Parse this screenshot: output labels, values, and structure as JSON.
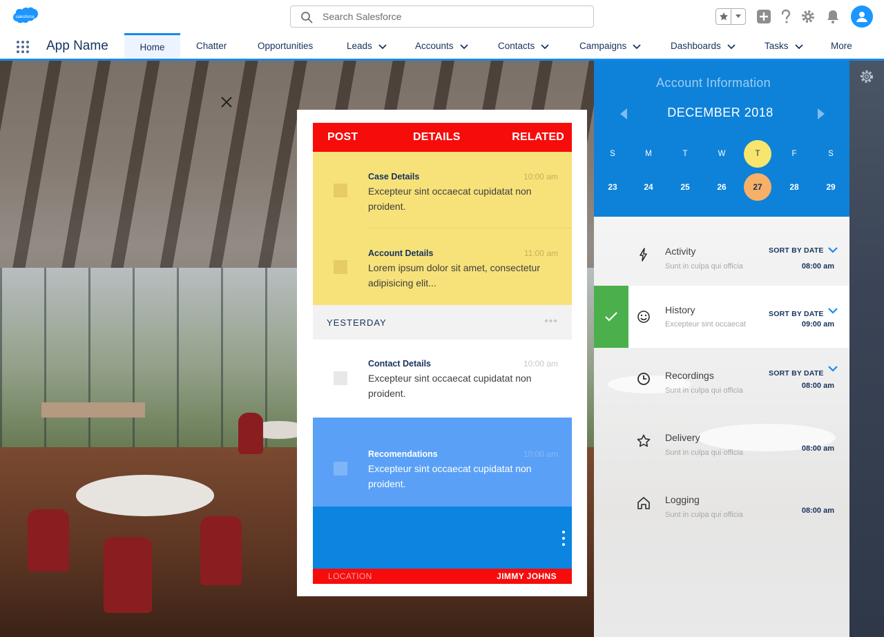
{
  "header": {
    "logo_text": "salesforce",
    "search_placeholder": "Search Salesforce"
  },
  "nav": {
    "app_name": "App Name",
    "tabs": [
      {
        "label": "Home",
        "active": true,
        "dropdown": false
      },
      {
        "label": "Chatter",
        "dropdown": false
      },
      {
        "label": "Opportunities",
        "dropdown": false
      },
      {
        "label": "Leads",
        "dropdown": true
      },
      {
        "label": "Accounts",
        "dropdown": true
      },
      {
        "label": "Contacts",
        "dropdown": true
      },
      {
        "label": "Campaigns",
        "dropdown": true
      },
      {
        "label": "Dashboards",
        "dropdown": true
      },
      {
        "label": "Tasks",
        "dropdown": true
      },
      {
        "label": "More",
        "dropdown": false
      }
    ]
  },
  "card": {
    "tabs": {
      "post": "POST",
      "details": "DETAILS",
      "related": "RELATED"
    },
    "items": [
      {
        "title": "Case Details",
        "time": "10:00 am",
        "body": "Excepteur sint occaecat cupidatat non proident."
      },
      {
        "title": "Account Details",
        "time": "11:00 am",
        "body": "Lorem ipsum dolor sit amet, consectetur adipisicing elit..."
      },
      {
        "title": "Contact Details",
        "time": "10:00 am",
        "body": "Excepteur sint occaecat cupidatat non proident."
      },
      {
        "title": "Recomendations",
        "time": "10:00 am",
        "body": "Excepteur sint occaecat cupidatat non proident."
      }
    ],
    "section_label": "YESTERDAY",
    "more_dots": "•••",
    "footer": {
      "location": "LOCATION",
      "name": "JIMMY JOHNS"
    }
  },
  "calendar": {
    "title": "Account Information",
    "month": "DECEMBER 2018",
    "days_of_week": [
      "S",
      "M",
      "T",
      "W",
      "T",
      "F",
      "S"
    ],
    "dates": [
      "23",
      "24",
      "25",
      "26",
      "27",
      "28",
      "29"
    ],
    "highlight_index": 4
  },
  "activities": [
    {
      "name": "Activity",
      "sub": "Sunt in culpa qui officia",
      "sort": "SORT BY DATE",
      "time": "08:00 am",
      "icon": "lightning-icon"
    },
    {
      "name": "History",
      "sub": "Excepteur sint occaecat",
      "sort": "SORT BY DATE",
      "time": "09:00 am",
      "icon": "smiley-icon",
      "selected": true
    },
    {
      "name": "Recordings",
      "sub": "Sunt in culpa qui officia",
      "sort": "SORT BY DATE",
      "time": "08:00 am",
      "icon": "clock-icon"
    },
    {
      "name": "Delivery",
      "sub": "Sunt in culpa qui officia",
      "sort": "",
      "time": "08:00 am",
      "icon": "star-icon"
    },
    {
      "name": "Logging",
      "sub": "Sunt in culpa qui officia",
      "sort": "",
      "time": "08:00 am",
      "icon": "home-icon"
    }
  ],
  "colors": {
    "accent_blue": "#1589ee",
    "card_red": "#f70c0c",
    "card_yellow": "#f7e27a",
    "calendar_blue": "#0e82d9",
    "success_green": "#4bb04b"
  }
}
